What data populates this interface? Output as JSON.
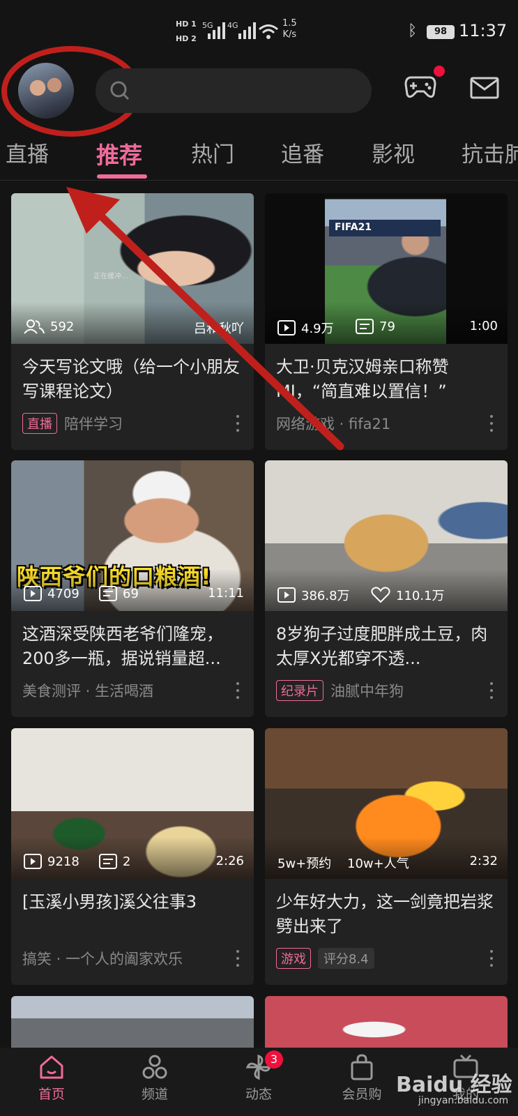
{
  "status_bar": {
    "hd1": "HD 1",
    "hd2": "HD 2",
    "net1": "5G",
    "net2": "4G",
    "speed_value": "1.5",
    "speed_unit": "K/s",
    "battery": "98",
    "time": "11:37"
  },
  "header": {
    "avatar_icon": "user-avatar",
    "search_icon": "search-icon",
    "game_icon": "gamepad-icon",
    "mail_icon": "mail-icon"
  },
  "tabs": [
    {
      "label": "直播"
    },
    {
      "label": "推荐"
    },
    {
      "label": "热门"
    },
    {
      "label": "追番"
    },
    {
      "label": "影视"
    },
    {
      "label": "抗击肺"
    }
  ],
  "cards": [
    {
      "stat1": "592",
      "stat1_icon": "people-icon",
      "stat_right": "吕和秋吖",
      "title": "今天写论文哦（给一个小朋友写课程论文）",
      "tag": "直播",
      "meta": "陪伴学习",
      "overlay": "正在缓冲..."
    },
    {
      "stat1": "4.9万",
      "stat1_icon": "play-icon",
      "stat2": "79",
      "stat2_icon": "danmaku-icon",
      "stat_right": "1:00",
      "title": "大卫·贝克汉姆亲口称赞MJ，“简直难以置信！”",
      "meta": "网络游戏 · fifa21",
      "overlay": "FIFA21"
    },
    {
      "stat1": "4709",
      "stat1_icon": "play-icon",
      "stat2": "69",
      "stat2_icon": "danmaku-icon",
      "stat_right": "11:11",
      "title": "这酒深受陕西老爷们隆宠，200多一瓶，据说销量超...",
      "meta": "美食测评 · 生活喝酒",
      "overlay": "陕西爷们的口粮酒!"
    },
    {
      "stat1": "386.8万",
      "stat1_icon": "play-icon",
      "stat2": "110.1万",
      "stat2_icon": "heart-icon",
      "title": "8岁狗子过度肥胖成土豆，肉太厚X光都穿不透...",
      "tag": "纪录片",
      "meta": "油腻中年狗"
    },
    {
      "stat1": "9218",
      "stat1_icon": "play-icon",
      "stat2": "2",
      "stat2_icon": "danmaku-icon",
      "stat_right": "2:26",
      "title": "[玉溪小男孩]溪父往事3",
      "meta": "搞笑 · 一个人的阖家欢乐"
    },
    {
      "stat1": "5w+预约",
      "stat2": "10w+人气",
      "stat_right": "2:32",
      "title": "少年好大力，这一剑竟把岩浆劈出来了",
      "tag": "游戏",
      "tag2": "评分8.4"
    }
  ],
  "bottom_nav": [
    {
      "label": "首页",
      "icon": "home-icon"
    },
    {
      "label": "频道",
      "icon": "channel-icon"
    },
    {
      "label": "动态",
      "icon": "pinwheel-icon",
      "badge": "3"
    },
    {
      "label": "会员购",
      "icon": "shopping-bag-icon"
    },
    {
      "label": "我的",
      "icon": "tv-icon"
    }
  ],
  "watermark": {
    "main": "Baidu 经验",
    "sub": "jingyan.baidu.com"
  },
  "colors": {
    "accent": "#f06b9a",
    "annotation_red": "#c0201c",
    "background": "#141414",
    "card": "#222222"
  }
}
